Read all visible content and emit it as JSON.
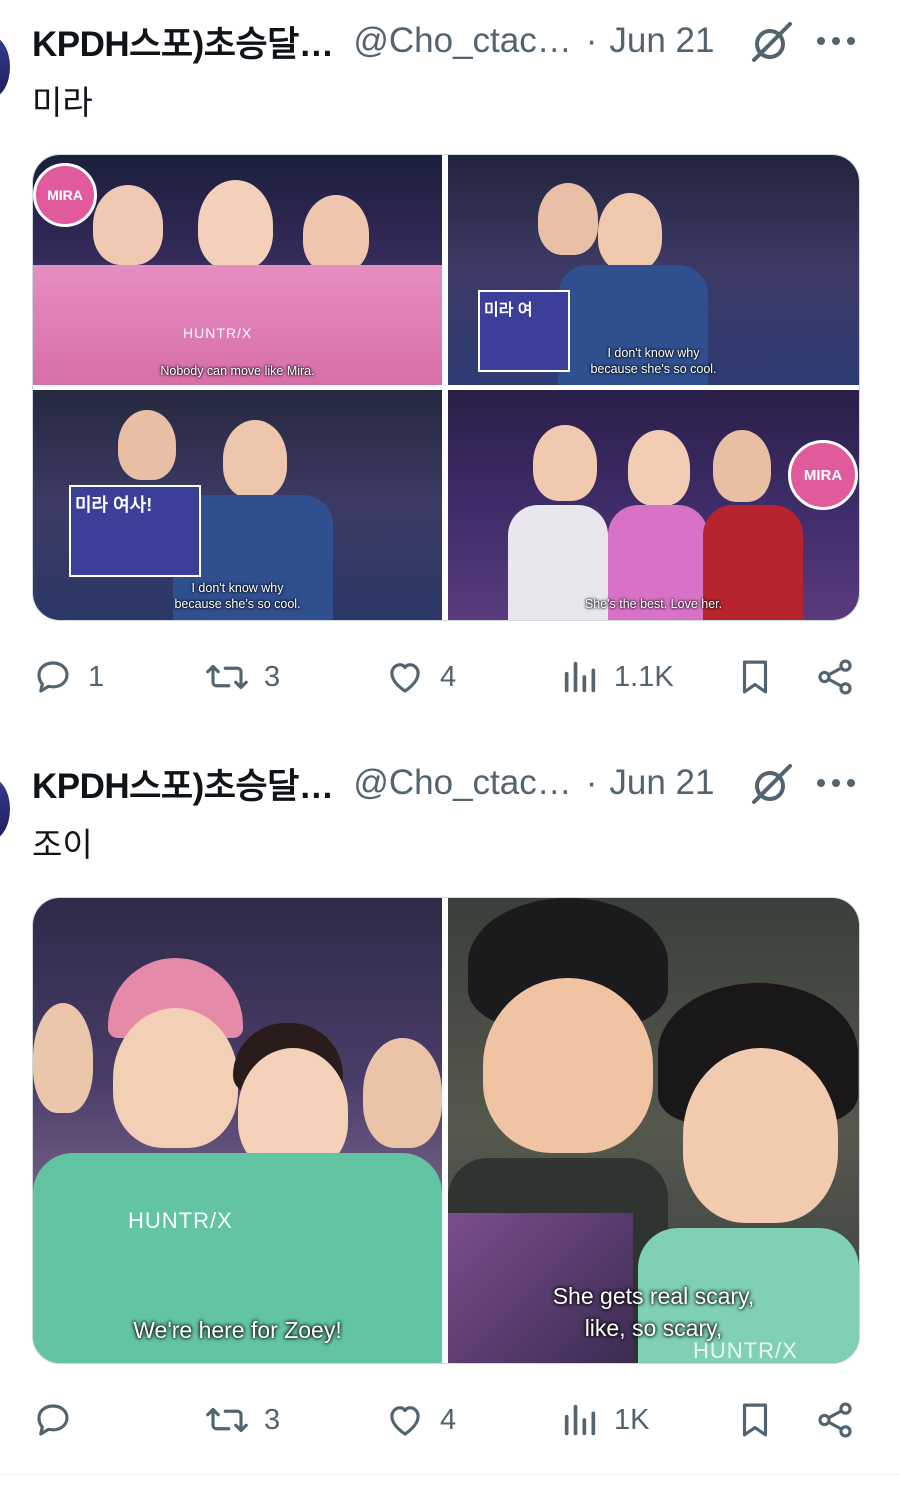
{
  "tweets": [
    {
      "author_name": "KPDH스포)초승달…",
      "handle": "@Cho_ctac…",
      "separator": "·",
      "date": "Jun 21",
      "text": "미라",
      "media": {
        "panels": [
          {
            "subtitle_lines": [
              "Nobody can move like Mira."
            ],
            "sign_text": "MIRA",
            "shirt_text": "HUNTR/X"
          },
          {
            "subtitle_lines": [
              "I don't know why",
              "because she's so cool."
            ],
            "sign_text": "미라 여"
          },
          {
            "subtitle_lines": [
              "I don't know why",
              "because she's so cool."
            ],
            "sign_text": "미라 여사!"
          },
          {
            "subtitle_lines": [
              "She's the best. Love her."
            ],
            "sign_text": "MIRA"
          }
        ]
      },
      "actions": {
        "replies": "1",
        "reposts": "3",
        "likes": "4",
        "views": "1.1K"
      }
    },
    {
      "author_name": "KPDH스포)초승달…",
      "handle": "@Cho_ctac…",
      "separator": "·",
      "date": "Jun 21",
      "text": "조이",
      "media": {
        "panels": [
          {
            "subtitle_lines": [
              "We're here for Zoey!"
            ],
            "shirt_text": "HUNTR/X"
          },
          {
            "subtitle_lines": [
              "She gets real scary,",
              "like, so scary,"
            ],
            "shirt_text": "HUNTR/X"
          }
        ]
      },
      "actions": {
        "replies": "",
        "reposts": "3",
        "likes": "4",
        "views": "1K"
      }
    }
  ],
  "colors": {
    "text_primary": "#0f1419",
    "text_secondary": "#536471",
    "border": "#cfd9de"
  },
  "icons": [
    "grok-icon",
    "more-icon",
    "reply-icon",
    "repost-icon",
    "like-icon",
    "views-icon",
    "bookmark-icon",
    "share-icon"
  ]
}
